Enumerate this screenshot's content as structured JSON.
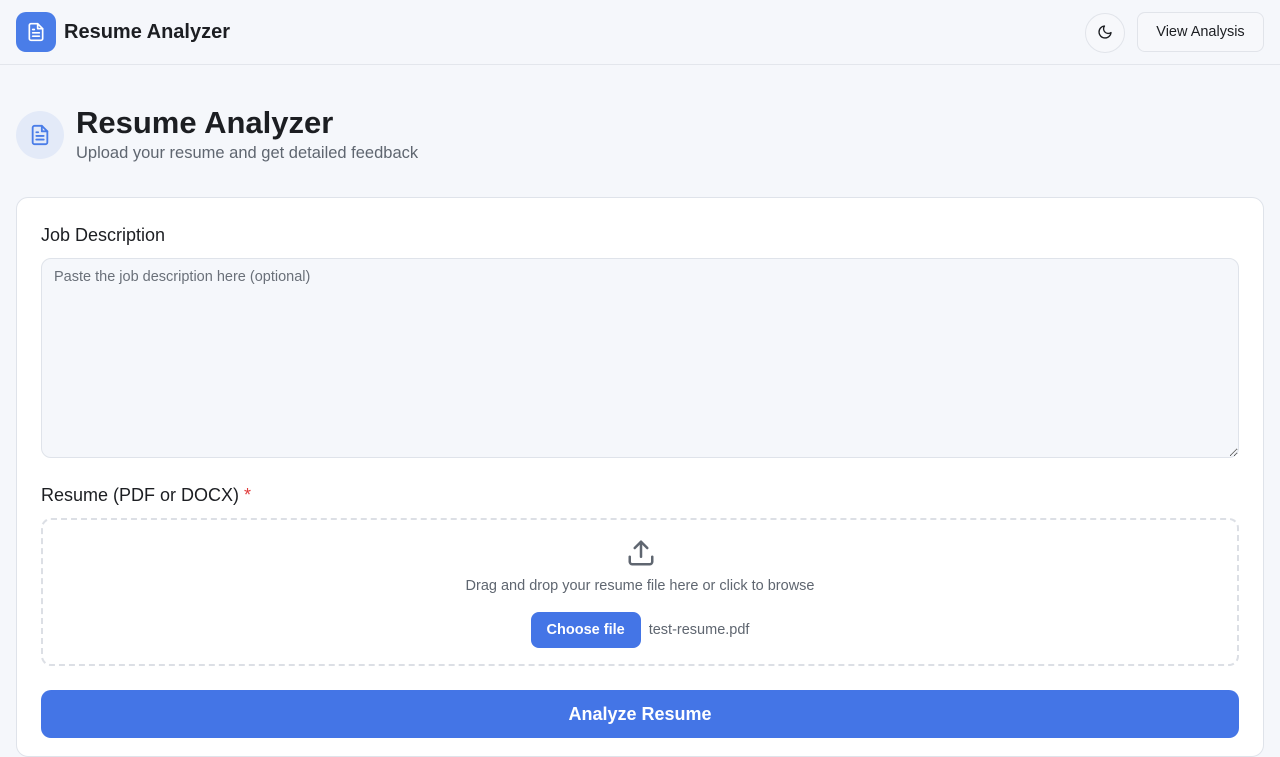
{
  "header": {
    "brand_title": "Resume Analyzer",
    "brand_icon": "file-text-icon",
    "theme_icon": "moon-icon",
    "view_analysis_label": "View Analysis"
  },
  "hero": {
    "title": "Resume Analyzer",
    "subtitle": "Upload your resume and get detailed feedback",
    "icon": "file-text-icon"
  },
  "form": {
    "job_description": {
      "label": "Job Description",
      "placeholder": "Paste the job description here (optional)",
      "value": ""
    },
    "resume": {
      "label": "Resume (PDF or DOCX)",
      "required_marker": "*",
      "dropzone_text": "Drag and drop your resume file here or click to browse",
      "upload_icon": "upload-icon",
      "choose_file_label": "Choose file",
      "selected_file": "test-resume.pdf"
    },
    "analyze_label": "Analyze Resume"
  },
  "colors": {
    "accent": "#4475e6",
    "background": "#f5f7fb",
    "required": "#e03b3b"
  }
}
